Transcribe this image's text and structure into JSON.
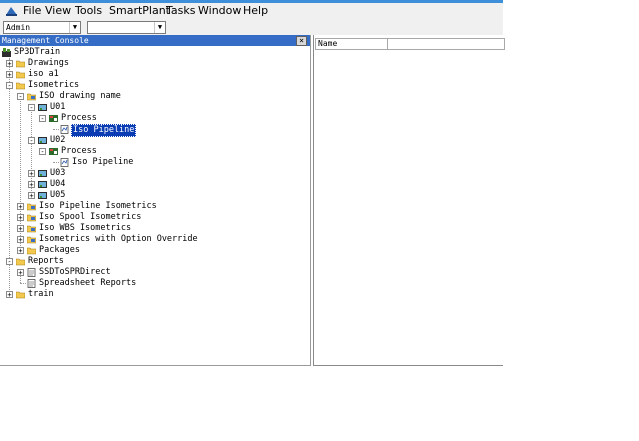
{
  "menubar": {
    "items": [
      "File",
      "View",
      "Tools",
      "SmartPlant",
      "Tasks",
      "Window",
      "Help"
    ]
  },
  "toolbar": {
    "user_combo_value": "Admin",
    "second_combo_value": ""
  },
  "console": {
    "title": "Management Console",
    "tree": [
      {
        "label": "SP3DTrain",
        "icon": "plant-icon",
        "exp": ""
      },
      {
        "label": "Drawings",
        "icon": "folder-icon",
        "exp": "+"
      },
      {
        "label": "iso a1",
        "icon": "folder-icon",
        "exp": "+"
      },
      {
        "label": "Isometrics",
        "icon": "folder-icon",
        "exp": "-"
      },
      {
        "label": "ISO drawing name",
        "icon": "iso-folder-icon",
        "exp": "-"
      },
      {
        "label": "U01",
        "icon": "unit-icon",
        "exp": "-"
      },
      {
        "label": "Process",
        "icon": "process-icon",
        "exp": "-"
      },
      {
        "label": "Iso Pipeline",
        "icon": "document-icon",
        "exp": "",
        "selected": true
      },
      {
        "label": "U02",
        "icon": "unit-icon",
        "exp": "-"
      },
      {
        "label": "Process",
        "icon": "process-icon",
        "exp": "-"
      },
      {
        "label": "Iso Pipeline",
        "icon": "document-icon",
        "exp": ""
      },
      {
        "label": "U03",
        "icon": "unit-icon",
        "exp": "+"
      },
      {
        "label": "U04",
        "icon": "unit-icon",
        "exp": "+"
      },
      {
        "label": "U05",
        "icon": "unit-icon",
        "exp": "+"
      },
      {
        "label": "Iso Pipeline Isometrics",
        "icon": "iso-folder-icon",
        "exp": "+"
      },
      {
        "label": "Iso Spool Isometrics",
        "icon": "iso-folder-icon",
        "exp": "+"
      },
      {
        "label": "Iso WBS Isometrics",
        "icon": "iso-folder-icon",
        "exp": "+"
      },
      {
        "label": "Isometrics with Option Override",
        "icon": "iso-folder-icon",
        "exp": "+"
      },
      {
        "label": "Packages",
        "icon": "folder-icon",
        "exp": "+"
      },
      {
        "label": "Reports",
        "icon": "folder-icon",
        "exp": "-"
      },
      {
        "label": "SSDToSPRDirect",
        "icon": "report-icon",
        "exp": "+"
      },
      {
        "label": "Spreadsheet Reports",
        "icon": "report-icon",
        "exp": ""
      },
      {
        "label": "train",
        "icon": "folder-icon",
        "exp": "+"
      }
    ]
  },
  "list": {
    "columns": [
      "Name"
    ]
  },
  "colors": {
    "accent": "#356cc6",
    "selection": "#0a3cb4",
    "folder": "#f2c94c"
  }
}
